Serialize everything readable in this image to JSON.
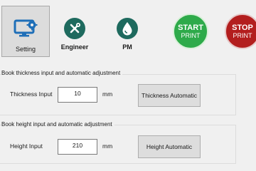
{
  "toolbar": {
    "setting_label": "Setting",
    "engineer_label": "Engineer",
    "pm_label": "PM",
    "start": {
      "line1": "START",
      "line2": "PRINT"
    },
    "stop": {
      "line1": "STOP",
      "line2": "PRINT"
    }
  },
  "thickness": {
    "group_title": "Book thickness input and automatic adjustment",
    "label": "Thickness Input",
    "value": "10",
    "unit": "mm",
    "button": "Thickness Automatic"
  },
  "height": {
    "group_title": "Book height input and automatic adjustment",
    "label": "Height Input",
    "value": "210",
    "unit": "mm",
    "button": "Height Automatic"
  },
  "colors": {
    "start": "#2eaa4a",
    "stop": "#b31e1e",
    "icon_teal": "#1e6a5e",
    "monitor_blue": "#1f6fb8"
  }
}
